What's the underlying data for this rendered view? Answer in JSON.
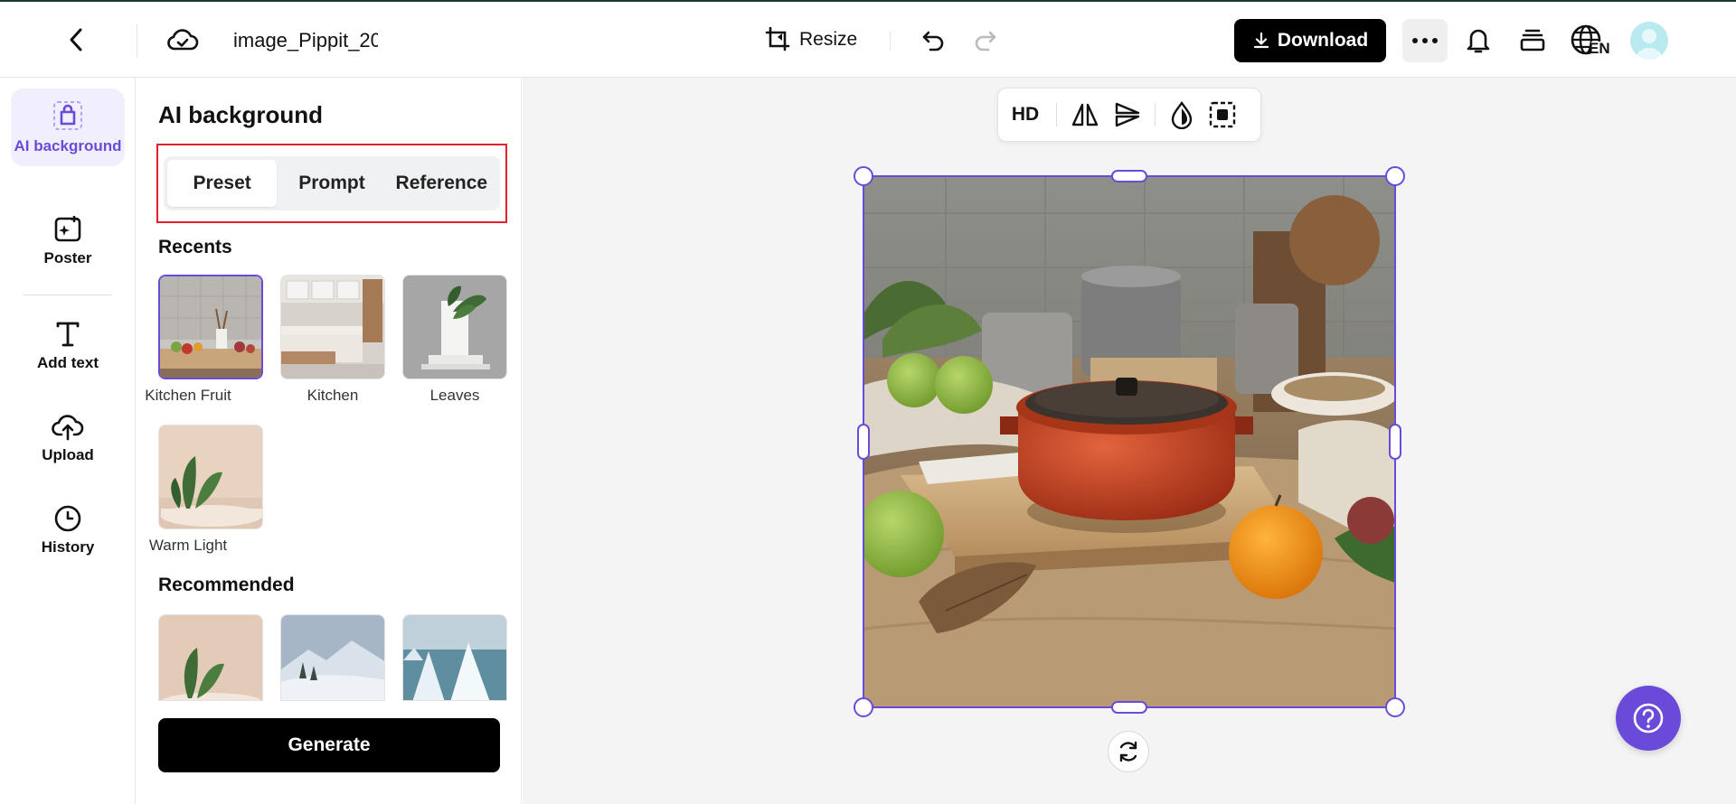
{
  "header": {
    "filename": "image_Pippit_20",
    "resize_label": "Resize",
    "download_label": "Download",
    "lang_badge": "EN"
  },
  "rail": {
    "items": [
      {
        "label": "AI background",
        "active": true
      },
      {
        "label": "Poster"
      },
      {
        "label": "Add text"
      },
      {
        "label": "Upload"
      },
      {
        "label": "History"
      }
    ]
  },
  "panel": {
    "title": "AI background",
    "tabs": [
      "Preset",
      "Prompt",
      "Reference"
    ],
    "active_tab": "Preset",
    "recents_title": "Recents",
    "recents": [
      {
        "label": "Kitchen Fruit",
        "selected": true
      },
      {
        "label": "Kitchen"
      },
      {
        "label": "Leaves"
      },
      {
        "label": "Warm Light"
      }
    ],
    "recommended_title": "Recommended",
    "generate_label": "Generate"
  },
  "canvas": {
    "toolbar": {
      "hd_label": "HD"
    }
  },
  "colors": {
    "accent": "#6a4bd9",
    "highlight_frame": "#e0202b",
    "primary_button": "#000000"
  }
}
